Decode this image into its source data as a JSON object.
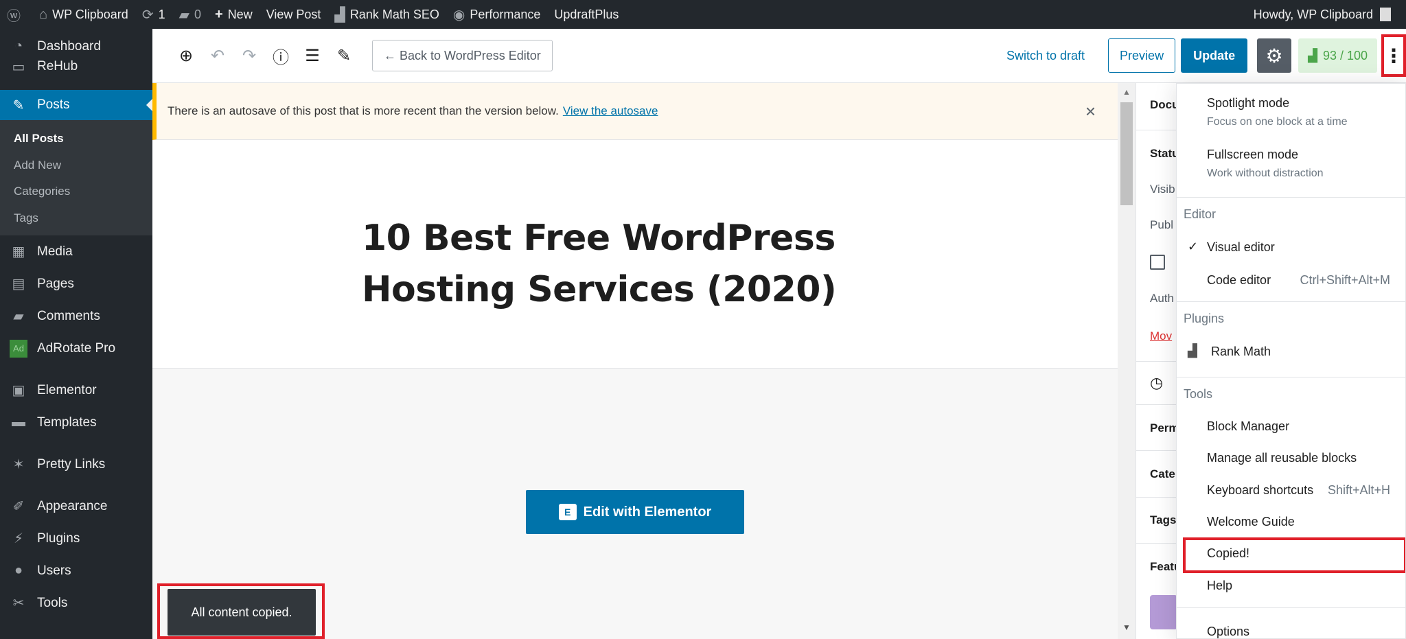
{
  "adminbar": {
    "items": [
      {
        "icon": "wordpress-icon",
        "glyph": "ⓦ",
        "label": ""
      },
      {
        "icon": "home-icon",
        "glyph": "⌂",
        "label": "WP Clipboard"
      },
      {
        "icon": "updates-icon",
        "glyph": "⟳",
        "label": "1"
      },
      {
        "icon": "comment-icon",
        "glyph": "▰",
        "label": "0"
      },
      {
        "icon": "plus-icon",
        "glyph": "+",
        "label": "New"
      },
      {
        "icon": "",
        "glyph": "",
        "label": "View Post"
      },
      {
        "icon": "rankmath-icon",
        "glyph": "▟",
        "label": "Rank Math SEO"
      },
      {
        "icon": "performance-icon",
        "glyph": "◉",
        "label": "Performance"
      },
      {
        "icon": "",
        "glyph": "",
        "label": "UpdraftPlus"
      }
    ],
    "howdy": "Howdy, WP Clipboard"
  },
  "sidebar": {
    "dashboard": "Dashboard",
    "rehub": "ReHub",
    "posts": "Posts",
    "submenu": [
      "All Posts",
      "Add New",
      "Categories",
      "Tags"
    ],
    "media": "Media",
    "pages": "Pages",
    "comments": "Comments",
    "adrotate_badge": "Ad",
    "adrotate": "AdRotate Pro",
    "elementor": "Elementor",
    "templates": "Templates",
    "pretty_links": "Pretty Links",
    "appearance": "Appearance",
    "plugins": "Plugins",
    "users": "Users",
    "tools": "Tools"
  },
  "header": {
    "back_label": "← Back to WordPress Editor",
    "switch_draft": "Switch to draft",
    "preview": "Preview",
    "update": "Update",
    "score": "93 / 100"
  },
  "notice": {
    "text": "There is an autosave of this post that is more recent than the version below.",
    "link": "View the autosave"
  },
  "post": {
    "title": "10 Best Free WordPress Hosting Services (2020)",
    "elementor_button": "Edit with Elementor",
    "elementor_badge": "E"
  },
  "settings": {
    "tab": "Docu",
    "status": "Statu",
    "visibility": "Visib",
    "publish": "Publ",
    "author": "Auth",
    "move": "Mov",
    "permalink": "Perm",
    "categories": "Cate",
    "tags": "Tags",
    "featured": "Featu"
  },
  "menu": {
    "spotlight": "Spotlight mode",
    "spotlight_desc": "Focus on one block at a time",
    "fullscreen": "Fullscreen mode",
    "fullscreen_desc": "Work without distraction",
    "editor_group": "Editor",
    "visual_editor": "Visual editor",
    "code_editor": "Code editor",
    "code_shortcut": "Ctrl+Shift+Alt+M",
    "plugins_group": "Plugins",
    "rank_math": "Rank Math",
    "tools_group": "Tools",
    "block_manager": "Block Manager",
    "reusable": "Manage all reusable blocks",
    "keyboard": "Keyboard shortcuts",
    "keyboard_shortcut": "Shift+Alt+H",
    "welcome": "Welcome Guide",
    "copied": "Copied!",
    "help": "Help",
    "options": "Options"
  },
  "snackbar": {
    "text": "All content copied."
  },
  "colors": {
    "admin_dark": "#23282d",
    "primary": "#0073aa",
    "highlight_red": "#e0202a",
    "notice_yellow": "#ffb900",
    "score_green": "#4ba54a"
  }
}
